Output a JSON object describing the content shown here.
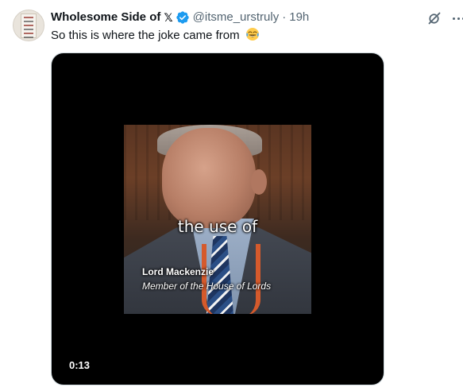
{
  "tweet": {
    "author": {
      "display_name": "Wholesome Side of",
      "x_glyph": "𝕏",
      "handle": "@itsme_urstruly",
      "verified_color": "#1d9bf0"
    },
    "separator": "·",
    "time": "19h",
    "text": "So this is where the joke came from",
    "emoji": "face-with-tears-of-joy",
    "icons": {
      "grok": "grok-icon",
      "more": "more-icon"
    }
  },
  "video": {
    "caption": "the use of",
    "lower_third": {
      "name": "Lord Mackenzie",
      "role": "Member of the House of Lords"
    },
    "duration": "0:13"
  }
}
